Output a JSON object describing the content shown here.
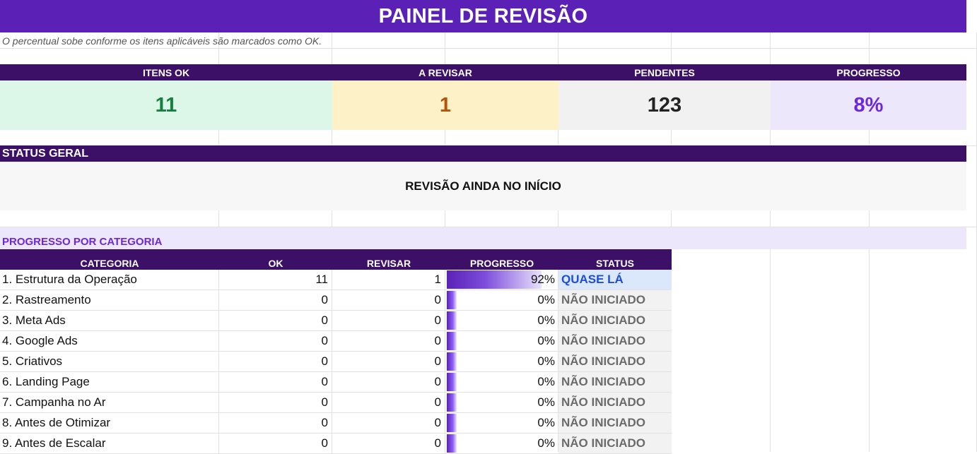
{
  "title": "PAINEL DE REVISÃO",
  "subtitle": "O percentual sobe conforme os itens aplicáveis são marcados como OK.",
  "kpis": [
    {
      "label": "ITENS OK",
      "value": "11",
      "color": "#15803d",
      "bg": "#dcf7e8"
    },
    {
      "label": "A REVISAR",
      "value": "1",
      "color": "#b45309",
      "bg": "#fdf1c7"
    },
    {
      "label": "PENDENTES",
      "value": "123",
      "color": "#222222",
      "bg": "#f1f1f1"
    },
    {
      "label": "PROGRESSO",
      "value": "8%",
      "color": "#6d28d9",
      "bg": "#ede7fb"
    }
  ],
  "status": {
    "header": "STATUS GERAL",
    "text": "REVISÃO AINDA NO INÍCIO"
  },
  "category_section": {
    "title": "PROGRESSO POR CATEGORIA",
    "columns": [
      "CATEGORIA",
      "OK",
      "REVISAR",
      "PROGRESSO",
      "STATUS"
    ],
    "rows": [
      {
        "name": "1. Estrutura da Operação",
        "ok": "11",
        "revisar": "1",
        "progress": 0.92,
        "progress_label": "92%",
        "status": "QUASE LÁ"
      },
      {
        "name": "2. Rastreamento",
        "ok": "0",
        "revisar": "0",
        "progress": 0,
        "progress_label": "0%",
        "status": "NÃO INICIADO"
      },
      {
        "name": "3. Meta Ads",
        "ok": "0",
        "revisar": "0",
        "progress": 0,
        "progress_label": "0%",
        "status": "NÃO INICIADO"
      },
      {
        "name": "4. Google Ads",
        "ok": "0",
        "revisar": "0",
        "progress": 0,
        "progress_label": "0%",
        "status": "NÃO INICIADO"
      },
      {
        "name": "5. Criativos",
        "ok": "0",
        "revisar": "0",
        "progress": 0,
        "progress_label": "0%",
        "status": "NÃO INICIADO"
      },
      {
        "name": "6. Landing Page",
        "ok": "0",
        "revisar": "0",
        "progress": 0,
        "progress_label": "0%",
        "status": "NÃO INICIADO"
      },
      {
        "name": "7. Campanha no Ar",
        "ok": "0",
        "revisar": "0",
        "progress": 0,
        "progress_label": "0%",
        "status": "NÃO INICIADO"
      },
      {
        "name": "8. Antes de Otimizar",
        "ok": "0",
        "revisar": "0",
        "progress": 0,
        "progress_label": "0%",
        "status": "NÃO INICIADO"
      },
      {
        "name": "9. Antes de Escalar",
        "ok": "0",
        "revisar": "0",
        "progress": 0,
        "progress_label": "0%",
        "status": "NÃO INICIADO"
      }
    ]
  }
}
